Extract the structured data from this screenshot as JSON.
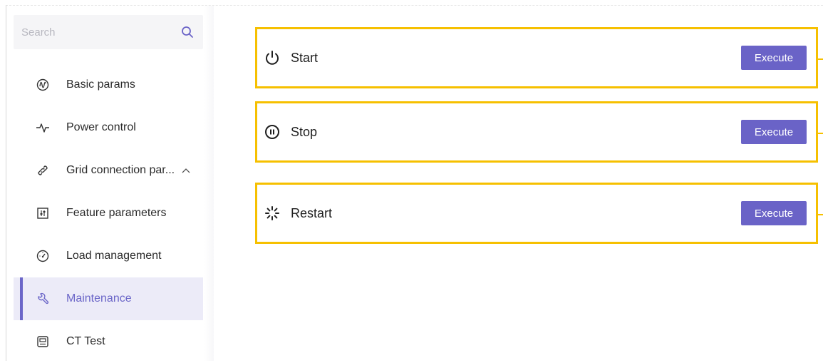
{
  "search": {
    "placeholder": "Search"
  },
  "sidebar": {
    "items": [
      {
        "label": "Basic params",
        "icon": "waveform-circle-icon"
      },
      {
        "label": "Power control",
        "icon": "pulse-icon"
      },
      {
        "label": "Grid connection par...",
        "icon": "link-icon",
        "expanded": true
      },
      {
        "label": "Feature parameters",
        "icon": "sliders-icon"
      },
      {
        "label": "Load management",
        "icon": "gauge-icon"
      },
      {
        "label": "Maintenance",
        "icon": "wrench-icon",
        "active": true
      },
      {
        "label": "CT Test",
        "icon": "meter-icon"
      }
    ]
  },
  "actions": [
    {
      "label": "Start",
      "icon": "power-icon",
      "button": "Execute"
    },
    {
      "label": "Stop",
      "icon": "pause-circle-icon",
      "button": "Execute"
    },
    {
      "label": "Restart",
      "icon": "loading-icon",
      "button": "Execute"
    }
  ],
  "colors": {
    "accent": "#6a63c7",
    "highlight_border": "#f6c000",
    "active_bg": "#ecebf8"
  }
}
